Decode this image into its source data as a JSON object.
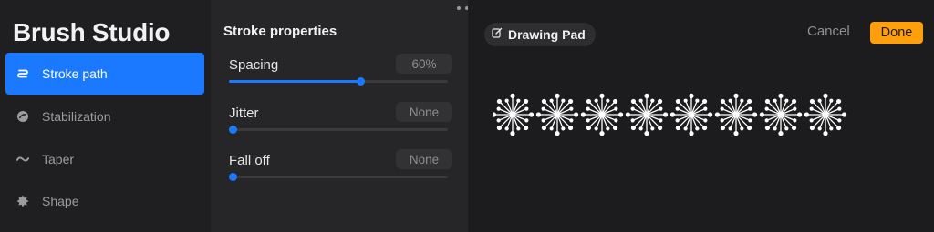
{
  "app": {
    "title": "Brush Studio"
  },
  "sidebar": {
    "items": [
      {
        "label": "Stroke path",
        "icon": "stroke-path-icon",
        "active": true
      },
      {
        "label": "Stabilization",
        "icon": "stabilization-icon",
        "active": false
      },
      {
        "label": "Taper",
        "icon": "taper-icon",
        "active": false
      },
      {
        "label": "Shape",
        "icon": "shape-icon",
        "active": false
      }
    ]
  },
  "properties": {
    "title": "Stroke properties",
    "items": [
      {
        "label": "Spacing",
        "value": "60%",
        "level": 0.6
      },
      {
        "label": "Jitter",
        "value": "None",
        "level": 0
      },
      {
        "label": "Fall off",
        "value": "None",
        "level": 0
      }
    ]
  },
  "drawing_pad": {
    "label": "Drawing Pad",
    "label_icon": "edit-icon",
    "cancel_label": "Cancel",
    "done_label": "Done",
    "stamp_count": 8
  },
  "colors": {
    "accent": "#1a79ff",
    "done": "#ff9f0a",
    "sidebar_bg": "#1f1f21",
    "panel_bg": "#262628",
    "pad_bg": "#1c1c1e"
  }
}
